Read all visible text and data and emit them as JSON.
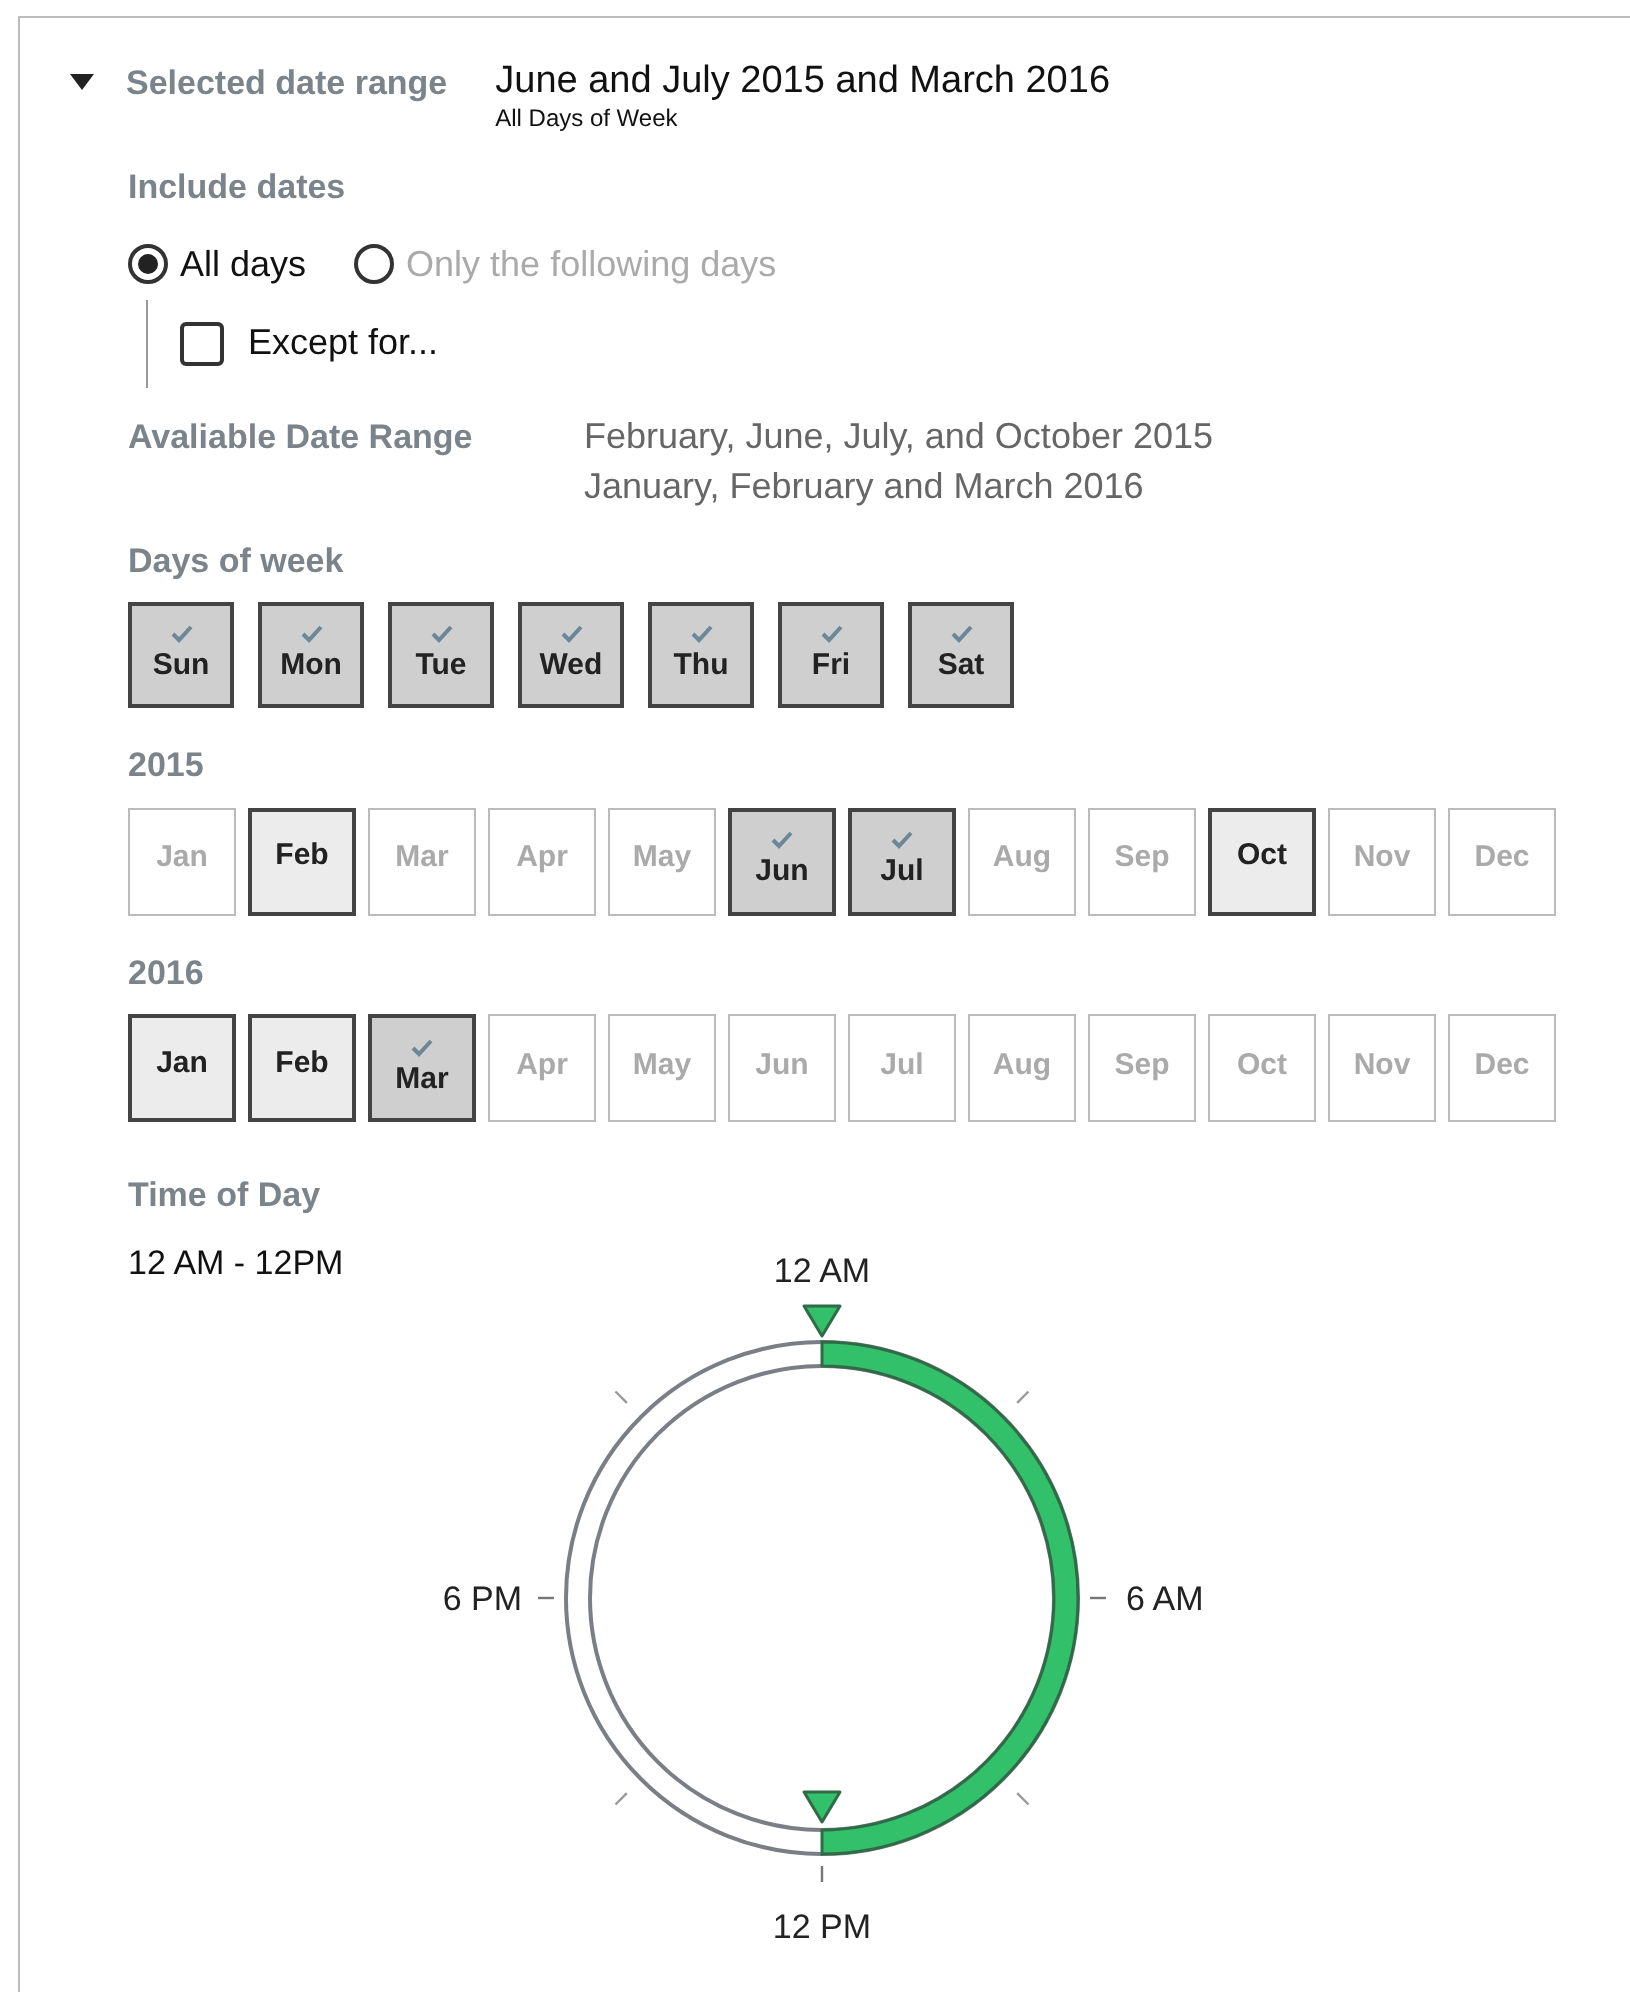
{
  "header": {
    "expanded": true,
    "label": "Selected date range",
    "value": "June and July 2015 and March 2016",
    "subvalue": "All Days of Week"
  },
  "include_dates": {
    "label": "Include dates",
    "options": [
      {
        "label": "All days",
        "selected": true
      },
      {
        "label": "Only the following days",
        "selected": false
      }
    ],
    "except": {
      "label": "Except for...",
      "checked": false
    }
  },
  "available_range": {
    "label": "Avaliable Date Range",
    "lines": [
      "February, June, July, and October 2015",
      "January, February and March 2016"
    ]
  },
  "days_of_week": {
    "label": "Days of week",
    "days": [
      {
        "label": "Sun",
        "selected": true
      },
      {
        "label": "Mon",
        "selected": true
      },
      {
        "label": "Tue",
        "selected": true
      },
      {
        "label": "Wed",
        "selected": true
      },
      {
        "label": "Thu",
        "selected": true
      },
      {
        "label": "Fri",
        "selected": true
      },
      {
        "label": "Sat",
        "selected": true
      }
    ]
  },
  "years": [
    {
      "label": "2015",
      "months": [
        {
          "label": "Jan",
          "available": false,
          "selected": false
        },
        {
          "label": "Feb",
          "available": true,
          "selected": false
        },
        {
          "label": "Mar",
          "available": false,
          "selected": false
        },
        {
          "label": "Apr",
          "available": false,
          "selected": false
        },
        {
          "label": "May",
          "available": false,
          "selected": false
        },
        {
          "label": "Jun",
          "available": true,
          "selected": true
        },
        {
          "label": "Jul",
          "available": true,
          "selected": true
        },
        {
          "label": "Aug",
          "available": false,
          "selected": false
        },
        {
          "label": "Sep",
          "available": false,
          "selected": false
        },
        {
          "label": "Oct",
          "available": true,
          "selected": false
        },
        {
          "label": "Nov",
          "available": false,
          "selected": false
        },
        {
          "label": "Dec",
          "available": false,
          "selected": false
        }
      ]
    },
    {
      "label": "2016",
      "months": [
        {
          "label": "Jan",
          "available": true,
          "selected": false
        },
        {
          "label": "Feb",
          "available": true,
          "selected": false
        },
        {
          "label": "Mar",
          "available": true,
          "selected": true
        },
        {
          "label": "Apr",
          "available": false,
          "selected": false
        },
        {
          "label": "May",
          "available": false,
          "selected": false
        },
        {
          "label": "Jun",
          "available": false,
          "selected": false
        },
        {
          "label": "Jul",
          "available": false,
          "selected": false
        },
        {
          "label": "Aug",
          "available": false,
          "selected": false
        },
        {
          "label": "Sep",
          "available": false,
          "selected": false
        },
        {
          "label": "Oct",
          "available": false,
          "selected": false
        },
        {
          "label": "Nov",
          "available": false,
          "selected": false
        },
        {
          "label": "Dec",
          "available": false,
          "selected": false
        }
      ]
    }
  ],
  "time_of_day": {
    "label": "Time of Day",
    "value": "12 AM - 12PM",
    "level": 0.5,
    "clock_labels": {
      "top": "12 AM",
      "right": "6 AM",
      "bottom": "12 PM",
      "left": "6 PM"
    }
  }
}
